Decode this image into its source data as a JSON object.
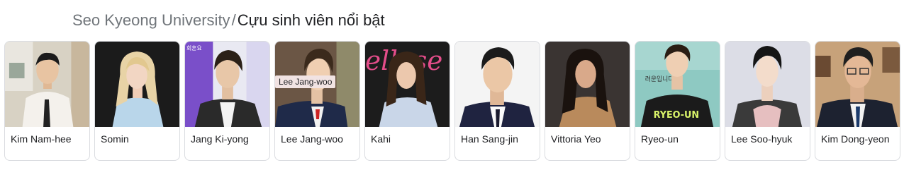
{
  "breadcrumb": {
    "university": "Seo Kyeong University",
    "separator": "/",
    "section": "Cựu sinh viên nổi bật"
  },
  "people": [
    {
      "name": "Kim Nam-hee",
      "icon": "person-photo"
    },
    {
      "name": "Somin",
      "icon": "person-photo"
    },
    {
      "name": "Jang Ki-yong",
      "icon": "person-photo"
    },
    {
      "name": "Lee Jang-woo",
      "icon": "person-photo"
    },
    {
      "name": "Kahi",
      "icon": "person-photo"
    },
    {
      "name": "Han Sang-jin",
      "icon": "person-photo"
    },
    {
      "name": "Vittoria Yeo",
      "icon": "person-photo"
    },
    {
      "name": "Ryeo-un",
      "icon": "person-photo"
    },
    {
      "name": "Lee Soo-hyuk",
      "icon": "person-photo"
    },
    {
      "name": "Kim Dong-yeon",
      "icon": "person-photo"
    }
  ],
  "tooltip": {
    "text": "Lee Jang-woo"
  },
  "photo_text": {
    "card3_sign": "회혼요",
    "card5_sign": "ellese",
    "card8_shirt": "RYEO-UN",
    "card8_sign": "려운입니다"
  },
  "colors": {
    "border": "#dadce0",
    "muted_text": "#70757a",
    "text": "#202124",
    "tooltip_bg": "#f1e3e3"
  }
}
